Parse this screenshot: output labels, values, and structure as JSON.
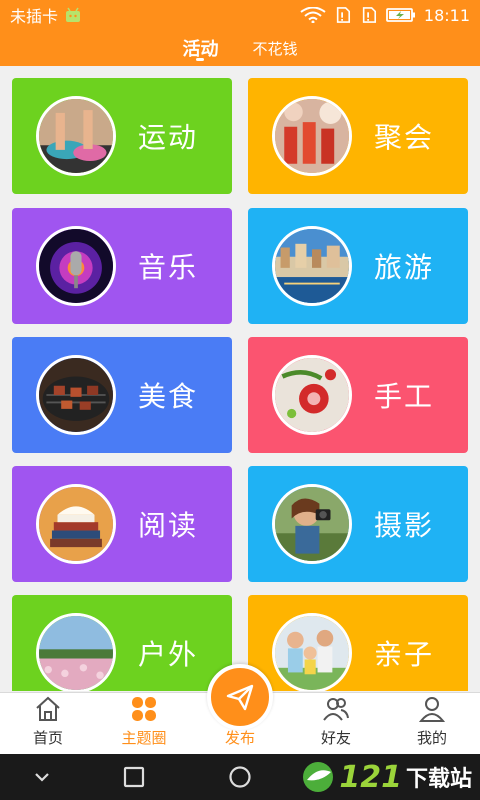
{
  "status_bar": {
    "carrier": "未插卡",
    "time": "18:11"
  },
  "tabs": [
    {
      "label": "活动",
      "active": true
    },
    {
      "label": "不花钱",
      "active": false
    }
  ],
  "categories": [
    {
      "label": "运动",
      "color": "#6dd21f",
      "photo": "sports-photo"
    },
    {
      "label": "聚会",
      "color": "#ffb400",
      "photo": "party-photo"
    },
    {
      "label": "音乐",
      "color": "#a055f0",
      "photo": "music-photo"
    },
    {
      "label": "旅游",
      "color": "#1fb2f4",
      "photo": "travel-photo"
    },
    {
      "label": "美食",
      "color": "#4a7cf5",
      "photo": "food-photo"
    },
    {
      "label": "手工",
      "color": "#fb5470",
      "photo": "handcraft-photo"
    },
    {
      "label": "阅读",
      "color": "#a055f0",
      "photo": "reading-photo"
    },
    {
      "label": "摄影",
      "color": "#1fb2f4",
      "photo": "photography-photo"
    },
    {
      "label": "户外",
      "color": "#6dd21f",
      "photo": "outdoor-photo"
    },
    {
      "label": "亲子",
      "color": "#ffb400",
      "photo": "family-photo"
    }
  ],
  "bottom_nav": {
    "home": "首页",
    "topics": "主题圈",
    "publish": "发布",
    "friends": "好友",
    "mine": "我的"
  },
  "accent_color": "#ff8f1a",
  "watermark": {
    "number": "121",
    "text": "下载站"
  }
}
